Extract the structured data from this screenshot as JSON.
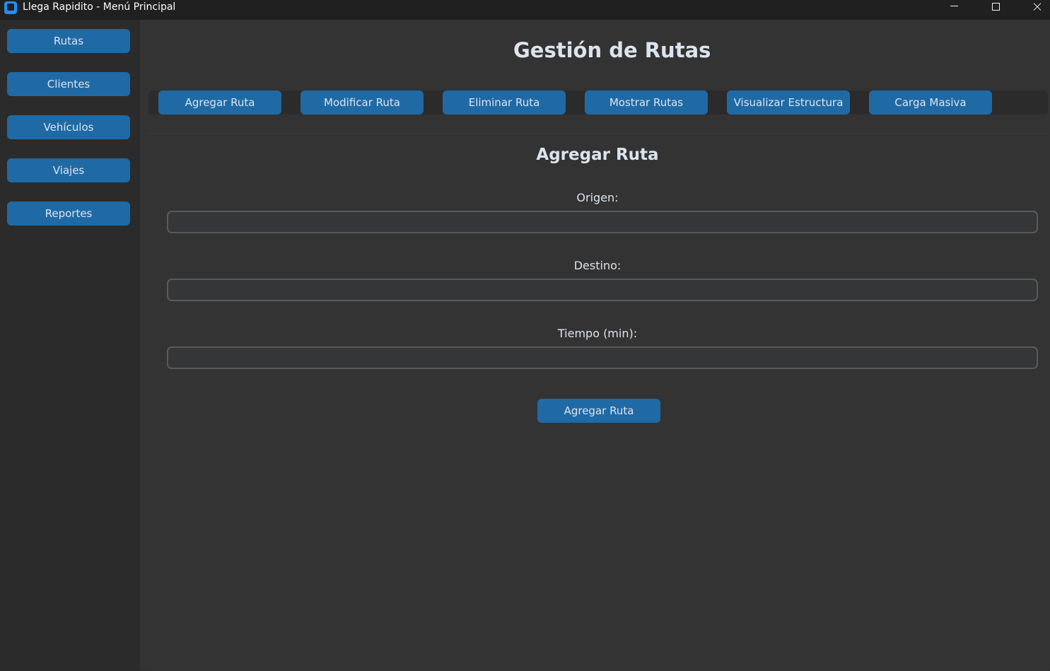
{
  "window": {
    "title": "Llega Rapidito - Menú Principal"
  },
  "sidebar": {
    "items": [
      {
        "label": "Rutas"
      },
      {
        "label": "Clientes"
      },
      {
        "label": "Vehículos"
      },
      {
        "label": "Viajes"
      },
      {
        "label": "Reportes"
      }
    ]
  },
  "main": {
    "title": "Gestión de Rutas",
    "tabs": [
      {
        "label": "Agregar Ruta"
      },
      {
        "label": "Modificar Ruta"
      },
      {
        "label": "Eliminar Ruta"
      },
      {
        "label": "Mostrar Rutas"
      },
      {
        "label": "Visualizar Estructura"
      },
      {
        "label": "Carga Masiva"
      }
    ]
  },
  "form": {
    "title": "Agregar Ruta",
    "fields": [
      {
        "label": "Origen:",
        "value": "",
        "placeholder": ""
      },
      {
        "label": "Destino:",
        "value": "",
        "placeholder": ""
      },
      {
        "label": "Tiempo (min):",
        "value": "",
        "placeholder": ""
      }
    ],
    "submit_label": "Agregar Ruta"
  },
  "colors": {
    "button_blue": "#1f6aa5",
    "sidebar_bg": "#2b2b2b",
    "content_bg": "#333333",
    "text": "#dce4ee",
    "input_border": "#565b5e"
  },
  "icons": [
    "app-icon",
    "minimize-icon",
    "maximize-icon",
    "close-icon"
  ]
}
